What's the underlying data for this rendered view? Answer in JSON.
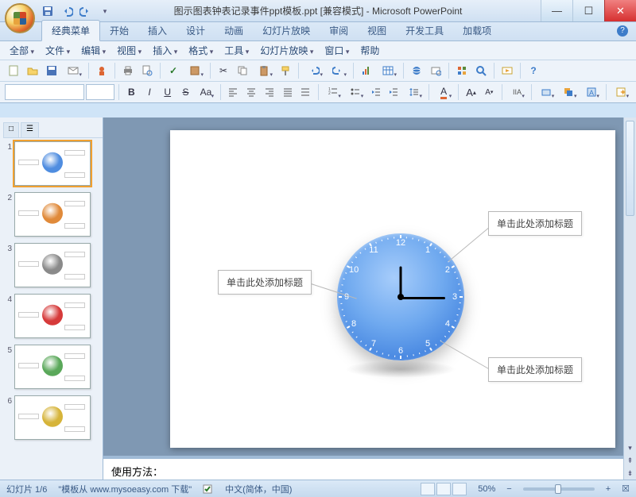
{
  "title": "图示图表钟表记录事件ppt模板.ppt [兼容模式] - Microsoft PowerPoint",
  "qat": {
    "save": "保存",
    "undo": "撤销",
    "redo": "重做"
  },
  "win": {
    "min": "—",
    "max": "☐",
    "close": "✕"
  },
  "ribbon_tabs": [
    "经典菜单",
    "开始",
    "插入",
    "设计",
    "动画",
    "幻灯片放映",
    "审阅",
    "视图",
    "开发工具",
    "加载项"
  ],
  "ribbon_active": 0,
  "classic_menu": [
    "全部",
    "文件",
    "编辑",
    "视图",
    "插入",
    "格式",
    "工具",
    "幻灯片放映",
    "窗口",
    "帮助"
  ],
  "font": {
    "name": "",
    "size": ""
  },
  "thumb_tabs": [
    "□",
    "☰"
  ],
  "slides": [
    {
      "n": "1",
      "color": "#4f8de0"
    },
    {
      "n": "2",
      "color": "#e08a3a"
    },
    {
      "n": "3",
      "color": "#8a8a8a"
    },
    {
      "n": "4",
      "color": "#d63a3a"
    },
    {
      "n": "5",
      "color": "#5aa85a"
    },
    {
      "n": "6",
      "color": "#d6b43a"
    }
  ],
  "slide": {
    "callouts": {
      "top_right": "单击此处添加标题",
      "left": "单击此处添加标题",
      "bottom_right": "单击此处添加标题"
    },
    "clock_numbers": [
      "12",
      "1",
      "2",
      "3",
      "4",
      "5",
      "6",
      "7",
      "8",
      "9",
      "10",
      "11"
    ]
  },
  "notes": "使用方法：",
  "status": {
    "slide_pos": "幻灯片 1/6",
    "template_src": "\"模板从 www.mysoeasy.com 下载\"",
    "lang": "中文(简体，中国)",
    "zoom": "50%",
    "fit": "☒"
  }
}
